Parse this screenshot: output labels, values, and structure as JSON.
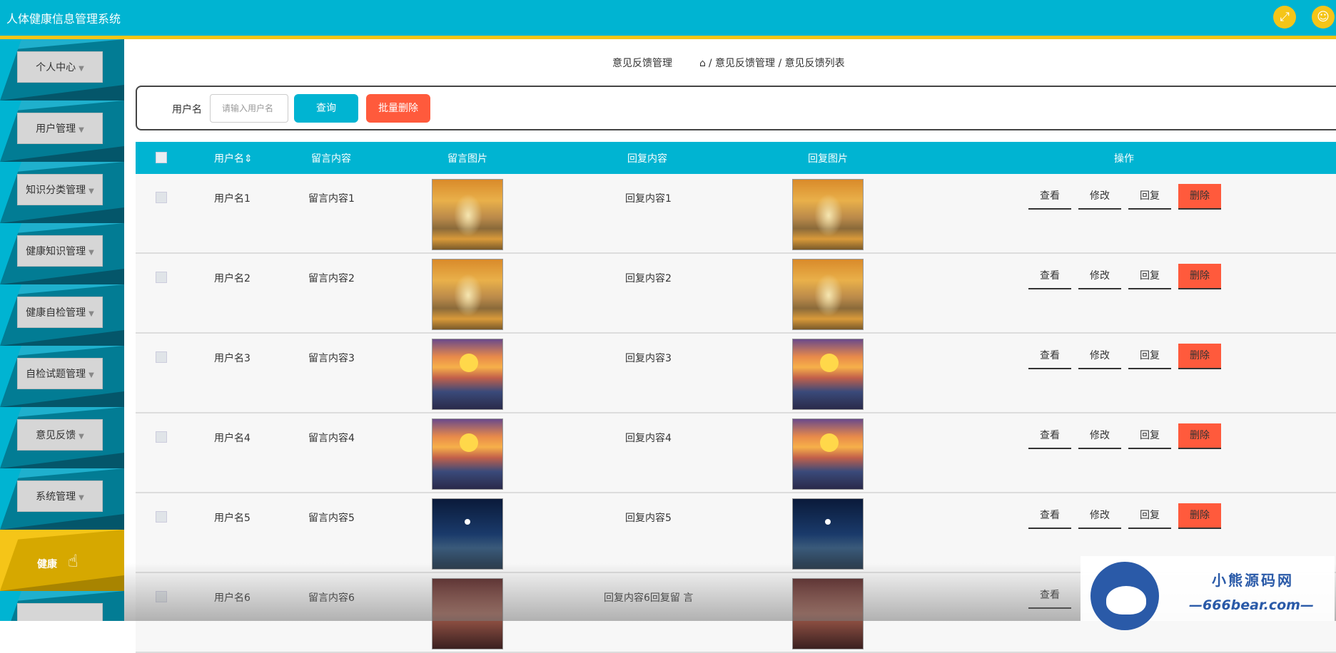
{
  "app": {
    "title": "人体健康信息管理系统"
  },
  "topbar": {
    "fullscreen_icon": "fullscreen-icon",
    "user_icon": "user-icon"
  },
  "sidebar": {
    "items": [
      {
        "label": "个人中心"
      },
      {
        "label": "用户管理"
      },
      {
        "label": "知识分类管理"
      },
      {
        "label": "健康知识管理"
      },
      {
        "label": "健康自检管理"
      },
      {
        "label": "自检试题管理"
      },
      {
        "label": "意见反馈"
      },
      {
        "label": "系统管理"
      },
      {
        "label": "健康"
      }
    ]
  },
  "breadcrumb": {
    "title": "意见反馈管理",
    "path": "/ 意见反馈管理 / 意见反馈列表"
  },
  "search": {
    "label": "用户名",
    "placeholder": "请输入用户名",
    "query_label": "查询",
    "batch_delete_label": "批量删除"
  },
  "table": {
    "headers": {
      "username": "用户名",
      "message": "留言内容",
      "message_image": "留言图片",
      "reply": "回复内容",
      "reply_image": "回复图片",
      "actions": "操作"
    },
    "rows": [
      {
        "username": "用户名1",
        "message": "留言内容1",
        "reply": "回复内容1",
        "image": "autumn"
      },
      {
        "username": "用户名2",
        "message": "留言内容2",
        "reply": "回复内容2",
        "image": "autumn"
      },
      {
        "username": "用户名3",
        "message": "留言内容3",
        "reply": "回复内容3",
        "image": "sunset"
      },
      {
        "username": "用户名4",
        "message": "留言内容4",
        "reply": "回复内容4",
        "image": "sunset"
      },
      {
        "username": "用户名5",
        "message": "留言内容5",
        "reply": "回复内容5",
        "image": "night"
      },
      {
        "username": "用户名6",
        "message": "留言内容6",
        "reply": "回复内容6回复留 言",
        "image": "dark"
      }
    ],
    "actions": {
      "view": "查看",
      "edit": "修改",
      "reply": "回复",
      "delete": "删除"
    }
  },
  "watermark": {
    "title": "小熊源码网",
    "url": "—666bear.com—"
  }
}
